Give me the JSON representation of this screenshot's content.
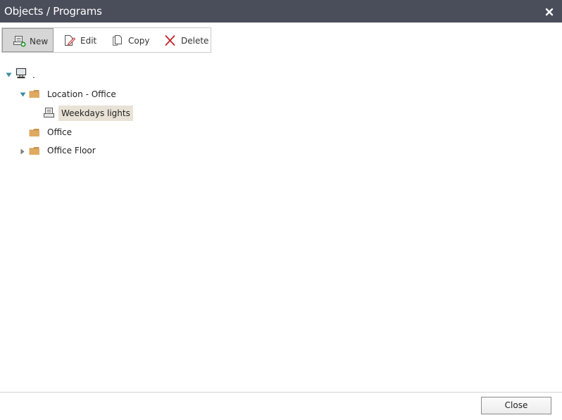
{
  "window": {
    "title": "Objects / Programs",
    "close_icon": "close-x-icon"
  },
  "toolbar": {
    "new_label": "New",
    "edit_label": "Edit",
    "copy_label": "Copy",
    "delete_label": "Delete"
  },
  "tree": {
    "root_label": ".",
    "nodes": [
      {
        "label": "Location - Office",
        "icon": "folder-icon",
        "expanded": true
      },
      {
        "label": "Weekdays lights",
        "icon": "program-icon",
        "selected": true
      },
      {
        "label": "Office",
        "icon": "folder-icon"
      },
      {
        "label": "Office Floor",
        "icon": "folder-icon",
        "expanded": false
      }
    ]
  },
  "footer": {
    "close_label": "Close"
  },
  "colors": {
    "titlebar_bg": "#4a4d5a",
    "tree_arrow": "#3a8fa0",
    "folder": "#d9a860",
    "selection": "#e8e2d6",
    "delete_x": "#c0262c"
  }
}
